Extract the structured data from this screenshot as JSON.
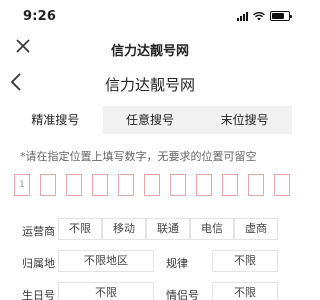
{
  "status_bar": {
    "time": "9:26"
  },
  "nav": {
    "title": "信力达靓号网"
  },
  "page": {
    "title": "信力达靓号网"
  },
  "tabs": [
    {
      "label": "精准搜号",
      "active": true
    },
    {
      "label": "任意搜号",
      "active": false
    },
    {
      "label": "末位搜号",
      "active": false
    }
  ],
  "hint": "*请在指定位置上填写数字，无要求的位置可留空",
  "digits": [
    "1",
    "",
    "",
    "",
    "",
    "",
    "",
    "",
    "",
    "",
    ""
  ],
  "filters": {
    "carrier": {
      "label": "运营商",
      "options": [
        "不限",
        "移动",
        "联通",
        "电信",
        "虚商"
      ]
    },
    "region": {
      "label": "归属地",
      "options": [
        "不限地区"
      ],
      "rule_label": "规律",
      "rule_value": "不限"
    },
    "birthday": {
      "label": "生日号",
      "value": "不限",
      "couple_label": "情侣号",
      "couple_value": "不限"
    }
  },
  "colors": {
    "digit_border": "#e6a6a6",
    "tab_bg": "#f1f1f1"
  }
}
